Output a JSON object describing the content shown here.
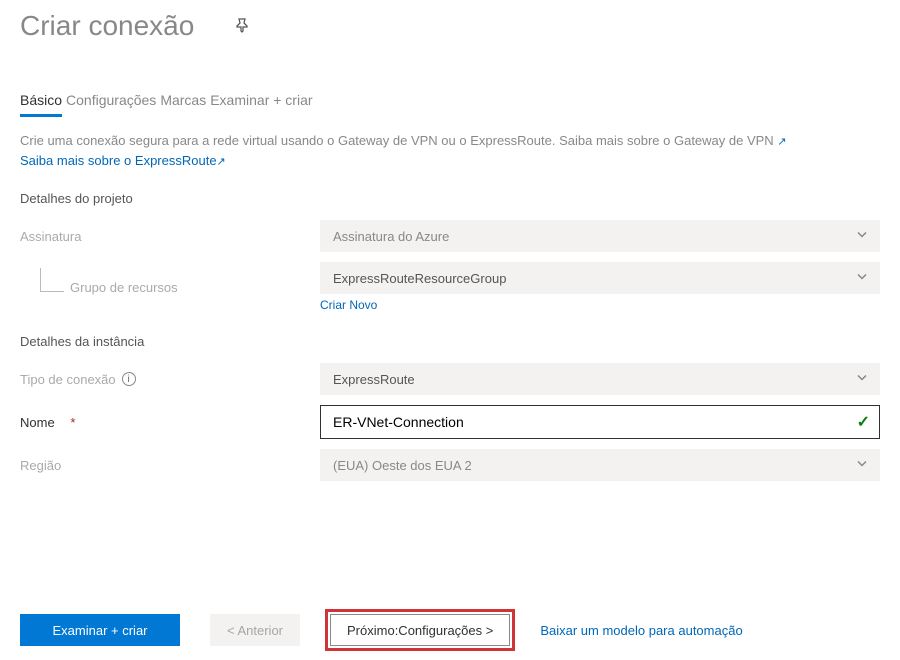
{
  "header": {
    "title": "Criar conexão"
  },
  "tabs": {
    "basic": "Básico",
    "settings": "Configurações",
    "tags": "Marcas",
    "review": "Examinar + criar"
  },
  "intro": {
    "line1": "Crie uma conexão segura para a rede virtual usando o Gateway de VPN ou o ExpressRoute. Saiba mais sobre o Gateway de VPN",
    "link2": "Saiba mais sobre o ExpressRoute"
  },
  "project": {
    "section": "Detalhes do projeto",
    "subscription_label": "Assinatura",
    "subscription_value": "Assinatura do Azure",
    "rg_label": "Grupo de recursos",
    "rg_value": "ExpressRouteResourceGroup",
    "rg_new": "Criar Novo"
  },
  "instance": {
    "section": "Detalhes da instância",
    "type_label": "Tipo de conexão",
    "type_value": "ExpressRoute",
    "name_label": "Nome",
    "name_value": "ER-VNet-Connection",
    "region_label": "Região",
    "region_value": "(EUA) Oeste dos EUA 2"
  },
  "footer": {
    "review": "Examinar + criar",
    "prev": "< Anterior",
    "next": "Próximo:Configurações >",
    "download": "Baixar um modelo para automação"
  }
}
